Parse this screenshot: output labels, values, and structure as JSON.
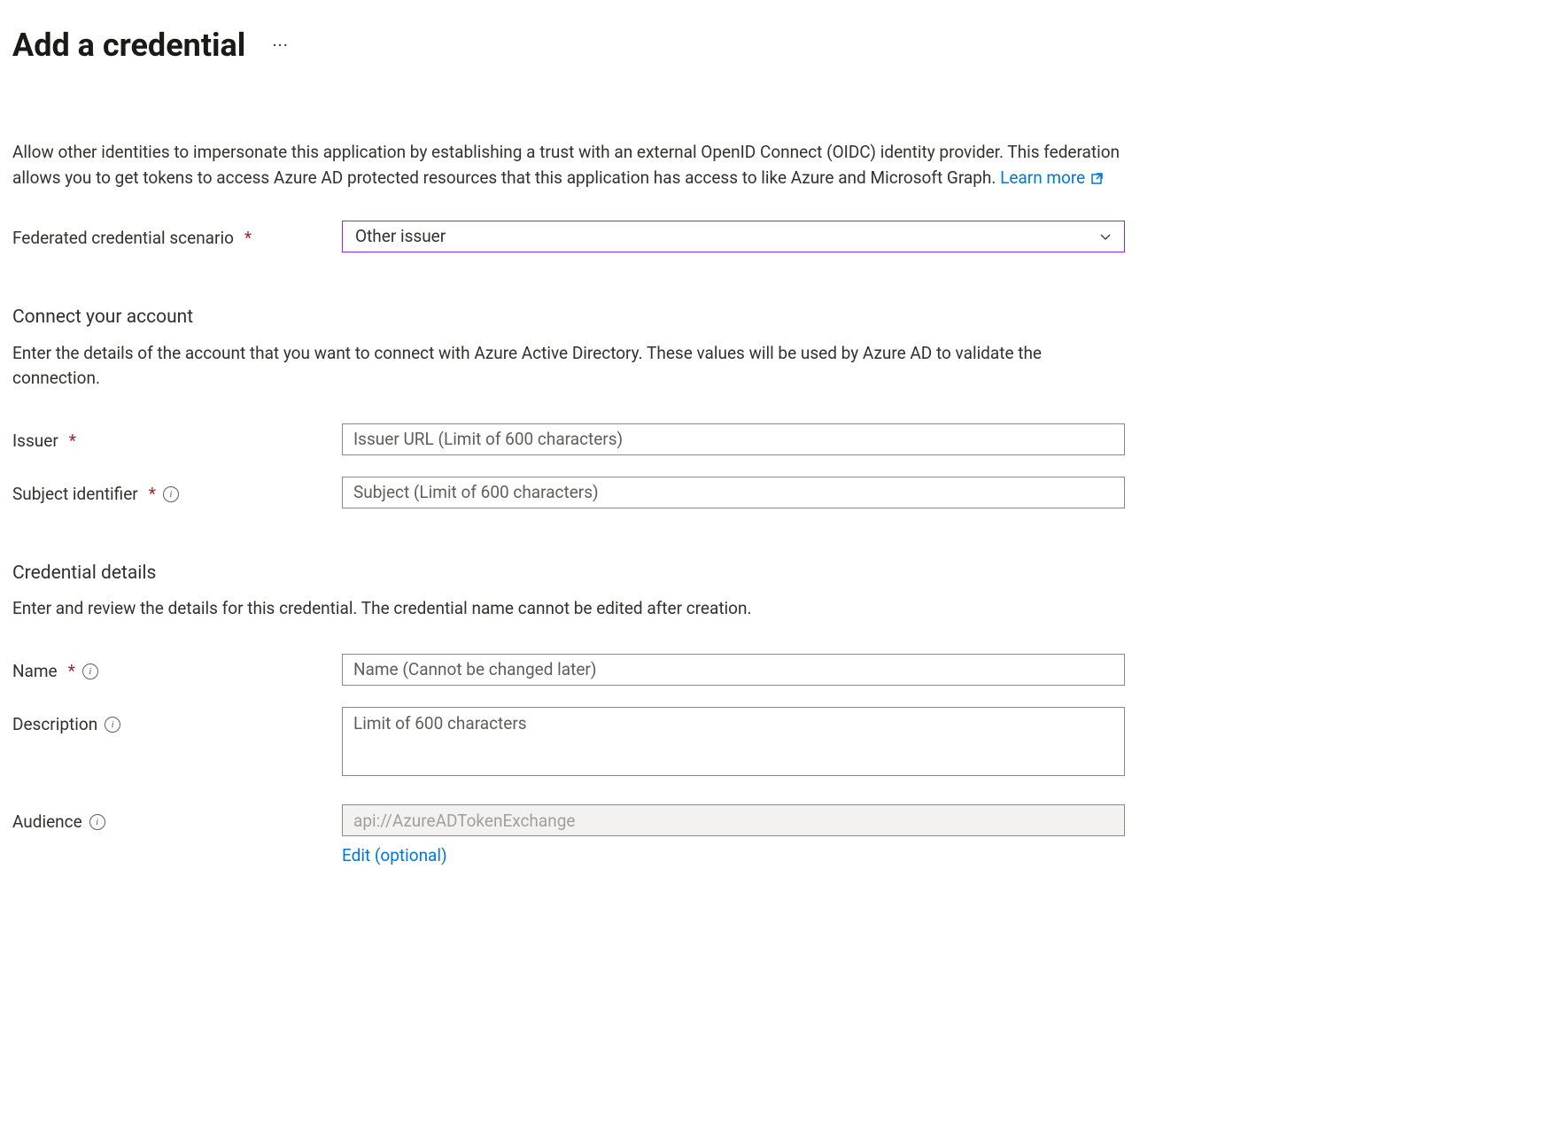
{
  "header": {
    "title": "Add a credential"
  },
  "intro": {
    "text": "Allow other identities to impersonate this application by establishing a trust with an external OpenID Connect (OIDC) identity provider. This federation allows you to get tokens to access Azure AD protected resources that this application has access to like Azure and Microsoft Graph. ",
    "learn_more": "Learn more"
  },
  "scenario": {
    "label": "Federated credential scenario",
    "value": "Other issuer"
  },
  "connect_section": {
    "title": "Connect your account",
    "desc": "Enter the details of the account that you want to connect with Azure Active Directory. These values will be used by Azure AD to validate the connection.",
    "issuer_label": "Issuer",
    "issuer_placeholder": "Issuer URL (Limit of 600 characters)",
    "subject_label": "Subject identifier",
    "subject_placeholder": "Subject (Limit of 600 characters)"
  },
  "details_section": {
    "title": "Credential details",
    "desc": "Enter and review the details for this credential. The credential name cannot be edited after creation.",
    "name_label": "Name",
    "name_placeholder": "Name (Cannot be changed later)",
    "description_label": "Description",
    "description_placeholder": "Limit of 600 characters",
    "audience_label": "Audience",
    "audience_value": "api://AzureADTokenExchange",
    "edit_link": "Edit (optional)"
  }
}
